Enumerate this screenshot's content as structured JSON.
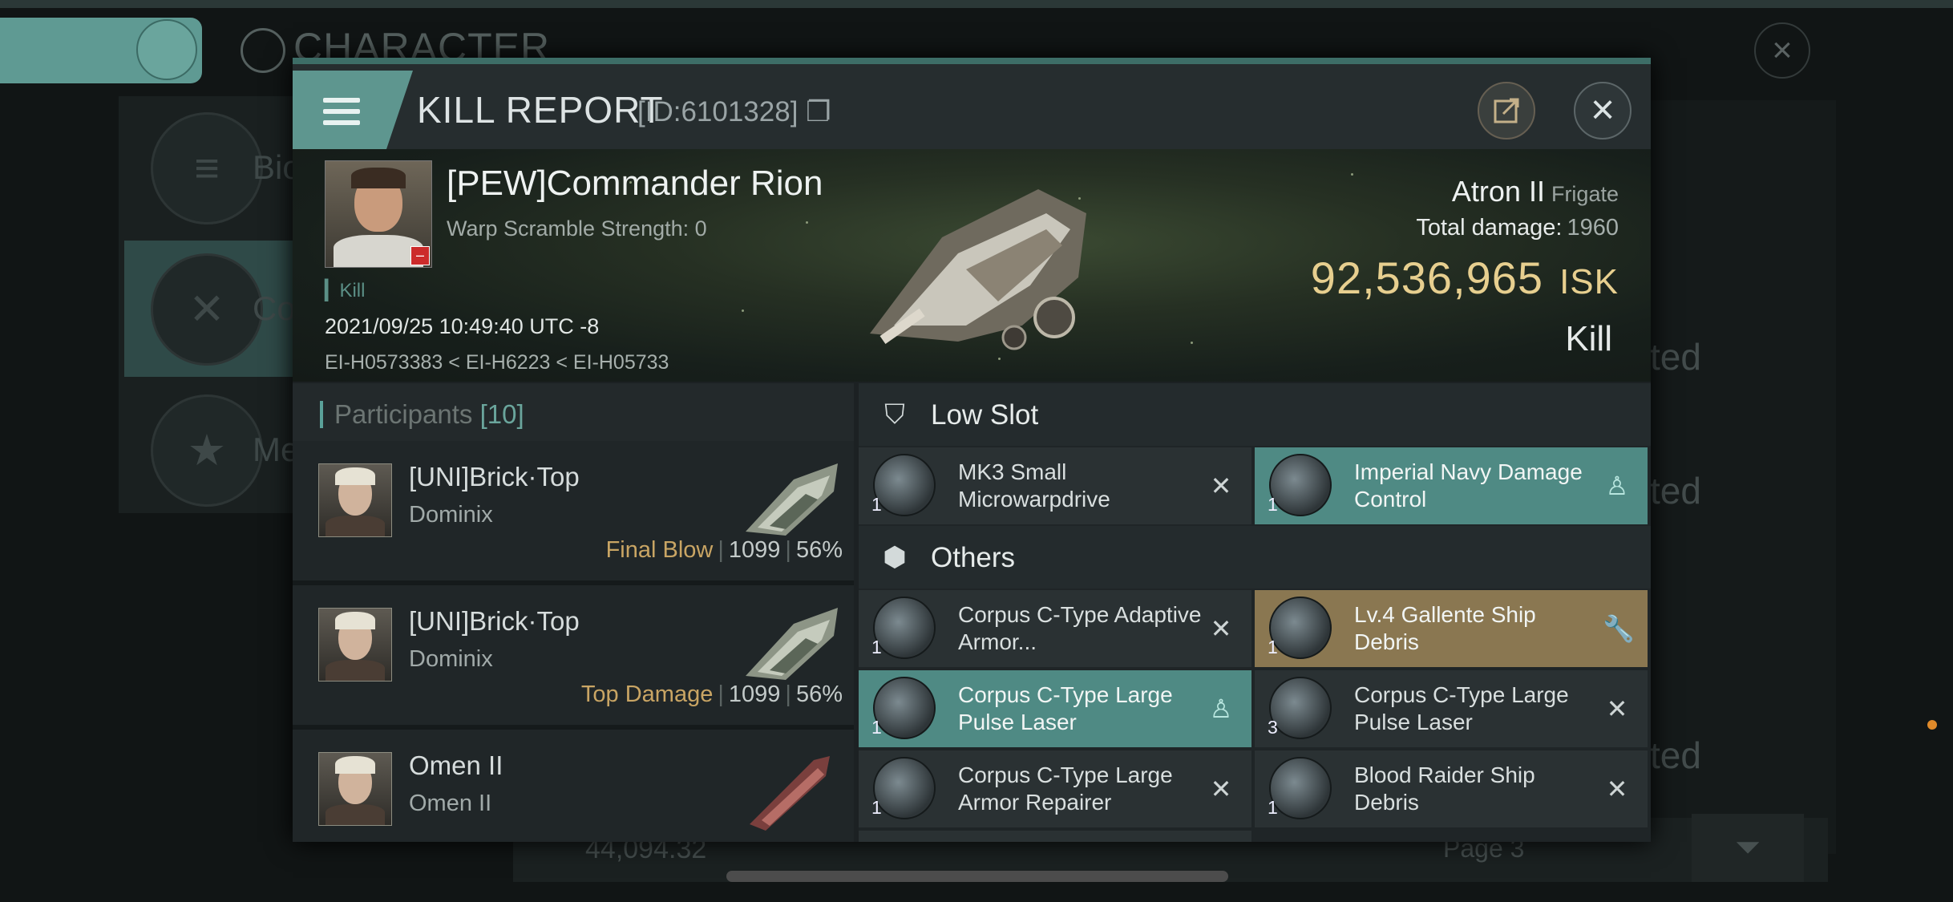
{
  "background": {
    "title": "CHARACTER",
    "side_items": [
      {
        "label": "Bio",
        "icon": "menu-icon"
      },
      {
        "label": "Co",
        "icon": "crossed-swords-icon"
      },
      {
        "label": "Me",
        "icon": "star-badge-icon"
      }
    ],
    "right_texts": [
      "ted",
      "ted",
      "ted"
    ],
    "bottom_value": "44,094.32",
    "page_label": "Page 3"
  },
  "dialog": {
    "title": "KILL REPORT",
    "id_label": "[ID:6101328]",
    "pilot": {
      "name": "[PEW]Commander Rion",
      "warp": "Warp Scramble Strength: 0",
      "kill_tag": "Kill",
      "datetime": "2021/09/25 10:49:40 UTC -8",
      "route": "EI-H0573383 < EI-H6223 < EI-H05733"
    },
    "ship": {
      "name": "Atron II",
      "class": "Frigate",
      "total_damage_label": "Total damage:",
      "total_damage": "1960",
      "isk_value": "92,536,965",
      "isk_unit": "ISK",
      "result": "Kill"
    },
    "participants": {
      "label": "Participants",
      "count": "[10]",
      "rows": [
        {
          "name": "[UNI]Brick·Top",
          "ship": "Dominix",
          "tag": "Final Blow",
          "damage": "1099",
          "percent": "56%"
        },
        {
          "name": "[UNI]Brick·Top",
          "ship": "Dominix",
          "tag": "Top Damage",
          "damage": "1099",
          "percent": "56%"
        },
        {
          "name": "Omen II",
          "ship": "Omen II",
          "tag": "",
          "damage": "",
          "percent": ""
        }
      ]
    },
    "low_slot": {
      "label": "Low Slot",
      "items": [
        {
          "name": "MK3 Small Microwarpdrive",
          "qty": "1",
          "state": "destroyed"
        },
        {
          "name": "Imperial Navy Damage Control",
          "qty": "1",
          "state": "dropped"
        }
      ]
    },
    "others": {
      "label": "Others",
      "items": [
        {
          "name": "Corpus C-Type Adaptive Armor...",
          "qty": "1",
          "state": "destroyed"
        },
        {
          "name": "Lv.4 Gallente Ship Debris",
          "qty": "1",
          "state": "salvage"
        },
        {
          "name": "Corpus C-Type Large Pulse Laser",
          "qty": "1",
          "state": "dropped"
        },
        {
          "name": "Corpus C-Type Large Pulse Laser",
          "qty": "3",
          "state": "destroyed"
        },
        {
          "name": "Corpus C-Type Large Armor Repairer",
          "qty": "1",
          "state": "destroyed"
        },
        {
          "name": "Blood Raider Ship Debris",
          "qty": "1",
          "state": "destroyed"
        }
      ]
    }
  },
  "colors": {
    "accent_teal": "#5e968f",
    "dropped_bg": "#4f8a84",
    "salvage_bg": "#8a7751",
    "isk_gold": "#e7cf8f"
  }
}
